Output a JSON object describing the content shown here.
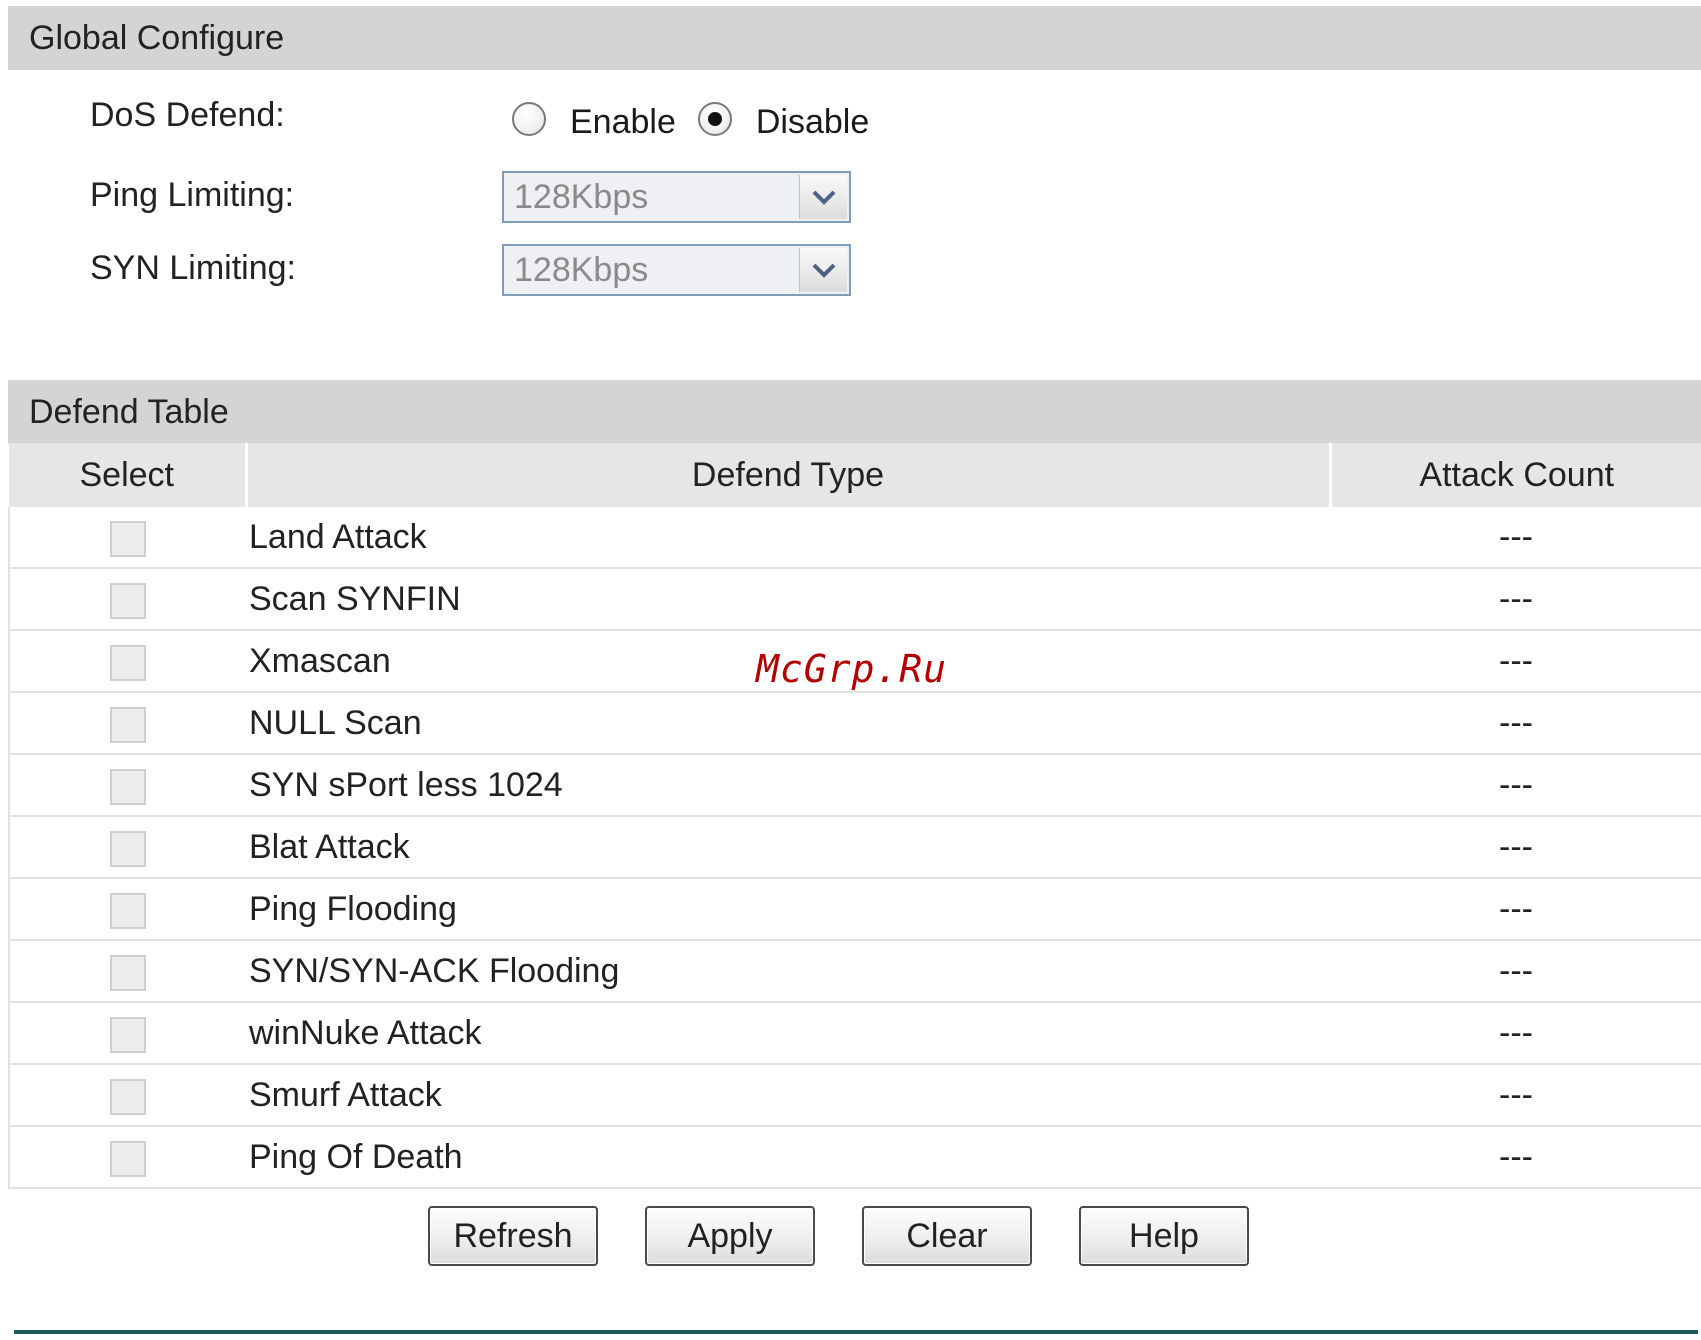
{
  "global_configure": {
    "title": "Global Configure",
    "dos_defend": {
      "label": "DoS Defend:",
      "options": [
        "Enable",
        "Disable"
      ],
      "selected": "Disable"
    },
    "ping_limiting": {
      "label": "Ping Limiting:",
      "value": "128Kbps"
    },
    "syn_limiting": {
      "label": "SYN Limiting:",
      "value": "128Kbps"
    }
  },
  "defend_table": {
    "title": "Defend Table",
    "columns": [
      "Select",
      "Defend Type",
      "Attack Count"
    ],
    "rows": [
      {
        "type": "Land Attack",
        "count": "---",
        "selected": false
      },
      {
        "type": "Scan SYNFIN",
        "count": "---",
        "selected": false
      },
      {
        "type": "Xmascan",
        "count": "---",
        "selected": false
      },
      {
        "type": "NULL Scan",
        "count": "---",
        "selected": false
      },
      {
        "type": "SYN sPort less 1024",
        "count": "---",
        "selected": false
      },
      {
        "type": "Blat Attack",
        "count": "---",
        "selected": false
      },
      {
        "type": "Ping Flooding",
        "count": "---",
        "selected": false
      },
      {
        "type": "SYN/SYN-ACK Flooding",
        "count": "---",
        "selected": false
      },
      {
        "type": "winNuke Attack",
        "count": "---",
        "selected": false
      },
      {
        "type": "Smurf Attack",
        "count": "---",
        "selected": false
      },
      {
        "type": "Ping Of Death",
        "count": "---",
        "selected": false
      }
    ]
  },
  "buttons": {
    "refresh": "Refresh",
    "apply": "Apply",
    "clear": "Clear",
    "help": "Help"
  },
  "watermark": "McGrp.Ru",
  "colors": {
    "section_bar": "#d4d4d4",
    "table_header": "#e6e6e6",
    "watermark": "#b40000",
    "footer_line": "#1f5a5a"
  }
}
